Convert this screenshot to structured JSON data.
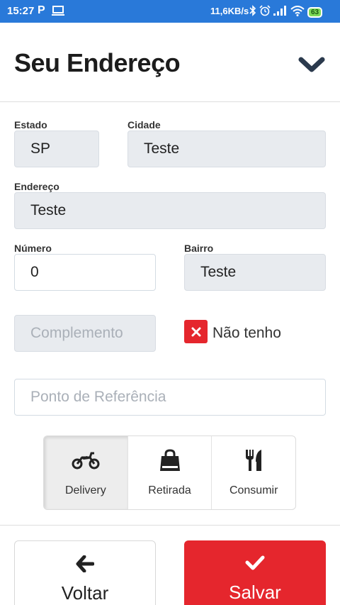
{
  "status_bar": {
    "time": "15:27",
    "p_label": "P",
    "speed": "11,6KB/s",
    "battery": "63"
  },
  "header": {
    "title": "Seu Endereço",
    "collapse_icon": "chevron-down-icon"
  },
  "form": {
    "estado": {
      "label": "Estado",
      "value": "SP"
    },
    "cidade": {
      "label": "Cidade",
      "value": "Teste"
    },
    "endereco": {
      "label": "Endereço",
      "value": "Teste"
    },
    "numero": {
      "label": "Número",
      "value": "0"
    },
    "bairro": {
      "label": "Bairro",
      "value": "Teste"
    },
    "complemento": {
      "placeholder": "Complemento"
    },
    "nao_tenho": {
      "label": "Não tenho",
      "checked": true
    },
    "referencia": {
      "placeholder": "Ponto de Referência"
    }
  },
  "modes": [
    {
      "label": "Delivery",
      "icon": "motorcycle-icon",
      "active": true
    },
    {
      "label": "Retirada",
      "icon": "shopping-bag-icon",
      "active": false
    },
    {
      "label": "Consumir",
      "icon": "cutlery-icon",
      "active": false
    }
  ],
  "actions": {
    "back_label": "Voltar",
    "save_label": "Salvar"
  },
  "colors": {
    "status_bar": "#2979d9",
    "accent": "#e5262d",
    "disabled_field": "#e8ebef"
  }
}
